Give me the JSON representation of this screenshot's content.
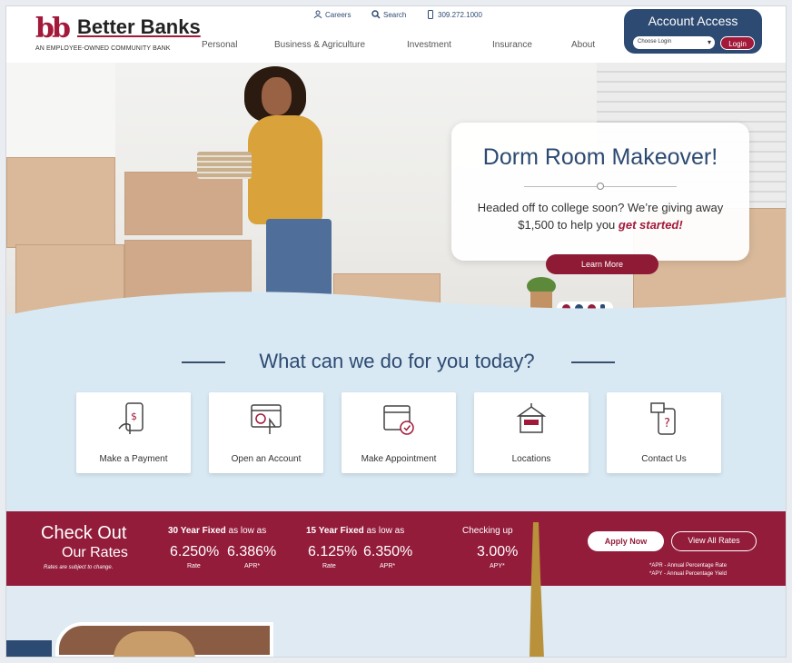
{
  "brand": {
    "mark": "bb",
    "name": "Better Banks",
    "tagline": "AN EMPLOYEE-OWNED COMMUNITY BANK",
    "accent": "#a3193a",
    "navy": "#2d4a72"
  },
  "utility": {
    "careers": "Careers",
    "search": "Search",
    "phone": "309.272.1000"
  },
  "nav": [
    "Personal",
    "Business & Agriculture",
    "Investment",
    "Insurance",
    "About"
  ],
  "account": {
    "title": "Account Access",
    "select_value": "Choose Login",
    "login": "Login"
  },
  "hero": {
    "title": "Dorm Room Makeover!",
    "text_main": "Headed off to college soon? We’re giving away $1,500 to help you",
    "text_emphasis": "get started!",
    "button": "Learn More"
  },
  "services": {
    "title": "What can we do for you today?",
    "tiles": [
      {
        "label": "Make a Payment",
        "icon": "payment-phone-icon"
      },
      {
        "label": "Open an Account",
        "icon": "open-account-icon"
      },
      {
        "label": "Make Appointment",
        "icon": "calendar-icon"
      },
      {
        "label": "Locations",
        "icon": "bank-building-icon"
      },
      {
        "label": "Contact Us",
        "icon": "contact-phone-icon"
      }
    ]
  },
  "rates": {
    "title_line1": "Check Out",
    "title_line2": "Our Rates",
    "disclaimer": "Rates are subject to change.",
    "groups": [
      {
        "head_bold": "30 Year Fixed",
        "head_rest": "as low as",
        "rate": "6.250%",
        "apr": "6.386%",
        "rate_label": "Rate",
        "apr_label": "APR*"
      },
      {
        "head_bold": "15 Year Fixed",
        "head_rest": "as low as",
        "rate": "6.125%",
        "apr": "6.350%",
        "rate_label": "Rate",
        "apr_label": "APR*"
      }
    ],
    "checking": {
      "head": "Checking up",
      "value": "3.00%",
      "label": "APY*"
    },
    "apply": "Apply Now",
    "view_all": "View All Rates",
    "note_apr": "*APR - Annual Percentage Rate",
    "note_apy": "*APY - Annual Percentage Yield"
  }
}
